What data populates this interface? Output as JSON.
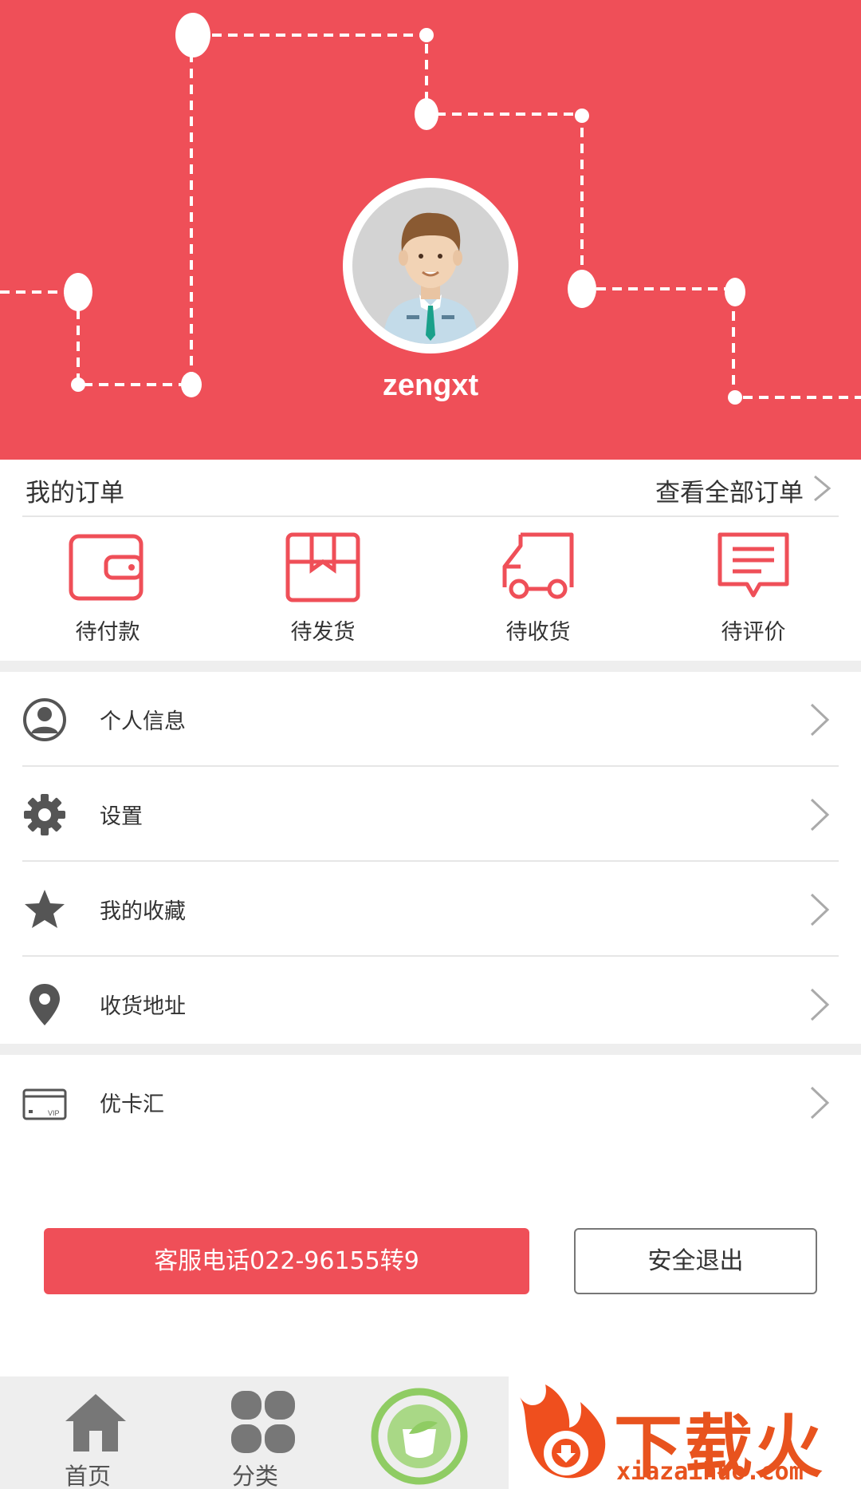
{
  "profile": {
    "username": "zengxt"
  },
  "orders": {
    "title": "我的订单",
    "view_all": "查看全部订单",
    "items": [
      {
        "label": "待付款",
        "icon": "wallet-icon"
      },
      {
        "label": "待发货",
        "icon": "package-icon"
      },
      {
        "label": "待收货",
        "icon": "truck-icon"
      },
      {
        "label": "待评价",
        "icon": "comment-icon"
      }
    ]
  },
  "menu": {
    "items": [
      {
        "label": "个人信息",
        "icon": "user-icon"
      },
      {
        "label": "设置",
        "icon": "gear-icon"
      },
      {
        "label": "我的收藏",
        "icon": "star-icon"
      },
      {
        "label": "收货地址",
        "icon": "location-pin-icon"
      },
      {
        "label": "优卡汇",
        "icon": "vip-card-icon"
      }
    ]
  },
  "actions": {
    "service_phone": "客服电话022-96155转9",
    "logout": "安全退出"
  },
  "bottom_nav": {
    "items": [
      {
        "label": "首页",
        "icon": "home-icon"
      },
      {
        "label": "分类",
        "icon": "category-icon"
      }
    ],
    "center_icon": "brand-logo-icon"
  },
  "ad": {
    "title": "下载火",
    "url": "xiazaihuo.com"
  },
  "colors": {
    "accent": "#ef4f58",
    "icon_gray": "#555555",
    "divider": "#e6e6e6",
    "background_gap": "#eeeeee",
    "ad_orange": "#e8531e"
  }
}
